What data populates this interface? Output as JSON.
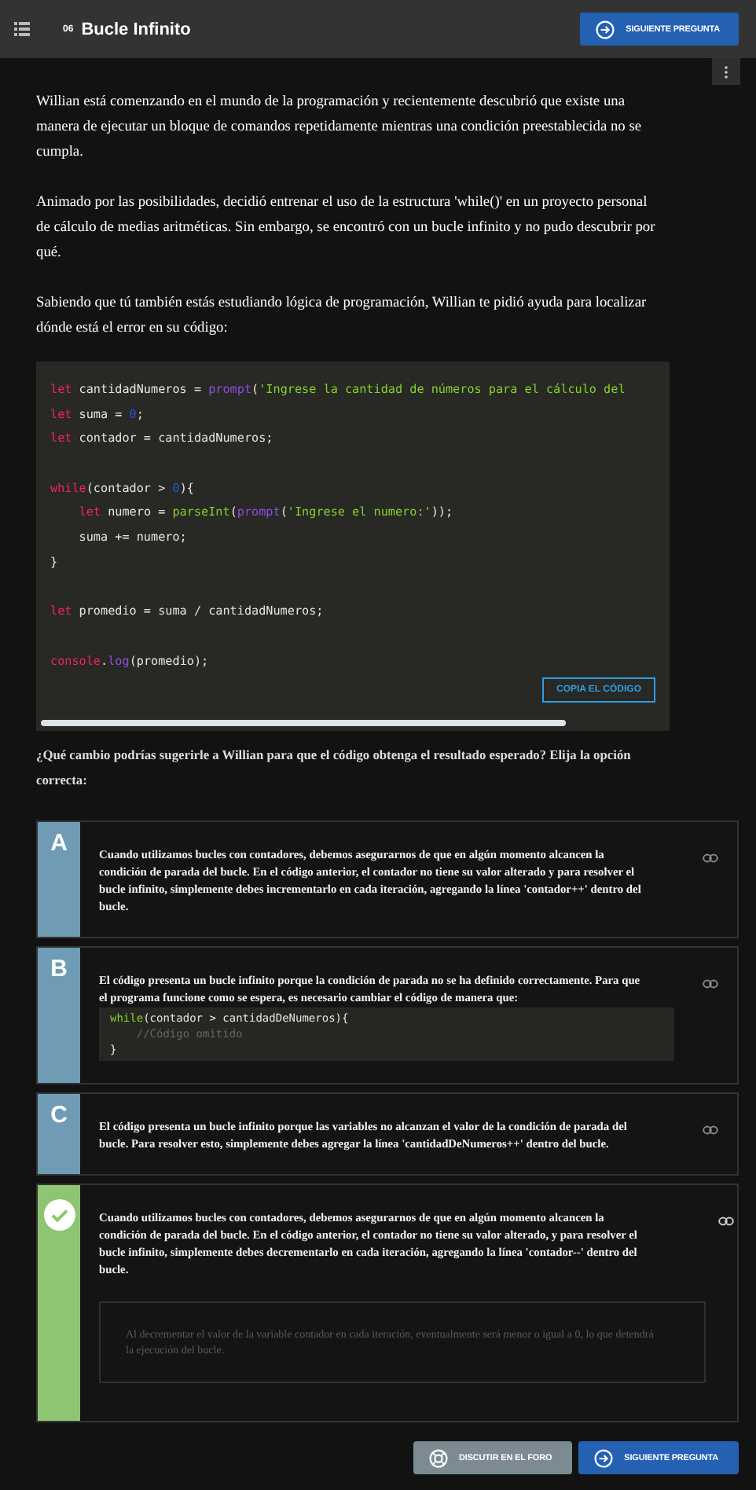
{
  "header": {
    "number": "06",
    "title": "Bucle Infinito",
    "next_button": "SIGUIENTE PREGUNTA"
  },
  "paragraphs": [
    "Willian está comenzando en el mundo de la programación y recientemente descubrió que existe una manera de ejecutar un bloque de comandos repetidamente mientras una condición preestablecida no se cumpla.",
    "Animado por las posibilidades, decidió entrenar el uso de la estructura 'while()' en un proyecto personal de cálculo de medias aritméticas. Sin embargo, se encontró con un bucle infinito y no pudo descubrir por qué.",
    "Sabiendo que tú también estás estudiando lógica de programación, Willian te pidió ayuda para localizar dónde está el error en su código:"
  ],
  "code": {
    "copy_button": "COPIA EL CÓDIGO",
    "blocks": [
      [
        [
          {
            "kind": "keyword",
            "text": "let"
          },
          {
            "kind": "plain",
            "text": " cantidadNumeros = "
          },
          {
            "kind": "function",
            "text": "prompt"
          },
          {
            "kind": "plain",
            "text": "("
          },
          {
            "kind": "string",
            "text": "'Ingrese la cantidad de números para el cálculo del"
          }
        ],
        [
          {
            "kind": "keyword",
            "text": "let"
          },
          {
            "kind": "plain",
            "text": " suma = "
          },
          {
            "kind": "number",
            "text": "0"
          },
          {
            "kind": "plain",
            "text": ";"
          }
        ],
        [
          {
            "kind": "keyword",
            "text": "let"
          },
          {
            "kind": "plain",
            "text": " contador = cantidadNumeros;"
          }
        ]
      ],
      [
        [
          {
            "kind": "keyword",
            "text": "while"
          },
          {
            "kind": "plain",
            "text": "(contador > "
          },
          {
            "kind": "number",
            "text": "0"
          },
          {
            "kind": "plain",
            "text": "){"
          }
        ],
        [
          {
            "kind": "keyword",
            "text": "    let"
          },
          {
            "kind": "plain",
            "text": " numero = "
          },
          {
            "kind": "builtin",
            "text": "parseInt"
          },
          {
            "kind": "plain",
            "text": "("
          },
          {
            "kind": "function",
            "text": "prompt"
          },
          {
            "kind": "plain",
            "text": "("
          },
          {
            "kind": "string",
            "text": "'Ingrese el numero:'"
          },
          {
            "kind": "plain",
            "text": "));"
          }
        ],
        [
          {
            "kind": "plain",
            "text": "    suma += numero;"
          }
        ],
        [
          {
            "kind": "plain",
            "text": "}"
          }
        ]
      ],
      [
        [
          {
            "kind": "keyword",
            "text": "let"
          },
          {
            "kind": "plain",
            "text": " promedio = suma / cantidadNumeros;"
          }
        ]
      ],
      [
        [
          {
            "kind": "keyword",
            "text": "console"
          },
          {
            "kind": "plain",
            "text": "."
          },
          {
            "kind": "function",
            "text": "log"
          },
          {
            "kind": "plain",
            "text": "(promedio);"
          }
        ]
      ]
    ]
  },
  "question": "¿Qué cambio podrías sugerirle a Willian para que el código obtenga el resultado esperado? Elija la opción correcta:",
  "options": [
    {
      "letter": "A",
      "correct": false,
      "text": "Cuando utilizamos bucles con contadores, debemos asegurarnos de que en algún momento alcancen la condición de parada del bucle. En el código anterior, el contador no tiene su valor alterado y para resolver el bucle infinito, simplemente debes incrementarlo en cada iteración, agregando la línea 'contador++' dentro del bucle."
    },
    {
      "letter": "B",
      "correct": false,
      "text": "El código presenta un bucle infinito porque la condición de parada no se ha definido correctamente. Para que el programa funcione como se espera, es necesario cambiar el código de manera que:",
      "code": [
        [
          {
            "kind": "builtin",
            "text": "while"
          },
          {
            "kind": "plain",
            "text": "(contador > cantidadDeNumeros){"
          }
        ],
        [
          {
            "kind": "comment",
            "text": "    //Código omitido"
          }
        ],
        [
          {
            "kind": "plain",
            "text": "}"
          }
        ]
      ]
    },
    {
      "letter": "C",
      "correct": false,
      "text": "El código presenta un bucle infinito porque las variables no alcanzan el valor de la condición de parada del bucle. Para resolver esto, simplemente debes agregar la línea 'cantidadDeNumeros++' dentro del bucle."
    },
    {
      "correct": true,
      "text": "Cuando utilizamos bucles con contadores, debemos asegurarnos de que en algún momento alcancen la condición de parada del bucle. En el código anterior, el contador no tiene su valor alterado, y para resolver el bucle infinito, simplemente debes decrementarlo en cada iteración, agregando la línea 'contador--' dentro del bucle.",
      "feedback": "Al decrementar el valor de la variable contador en cada iteración, eventualmente será menor o igual a 0, lo que detendrá la ejecución del bucle."
    }
  ],
  "footer": {
    "forum_button": "DISCUTIR EN EL FORO",
    "next_button": "SIGUIENTE PREGUNTA"
  }
}
